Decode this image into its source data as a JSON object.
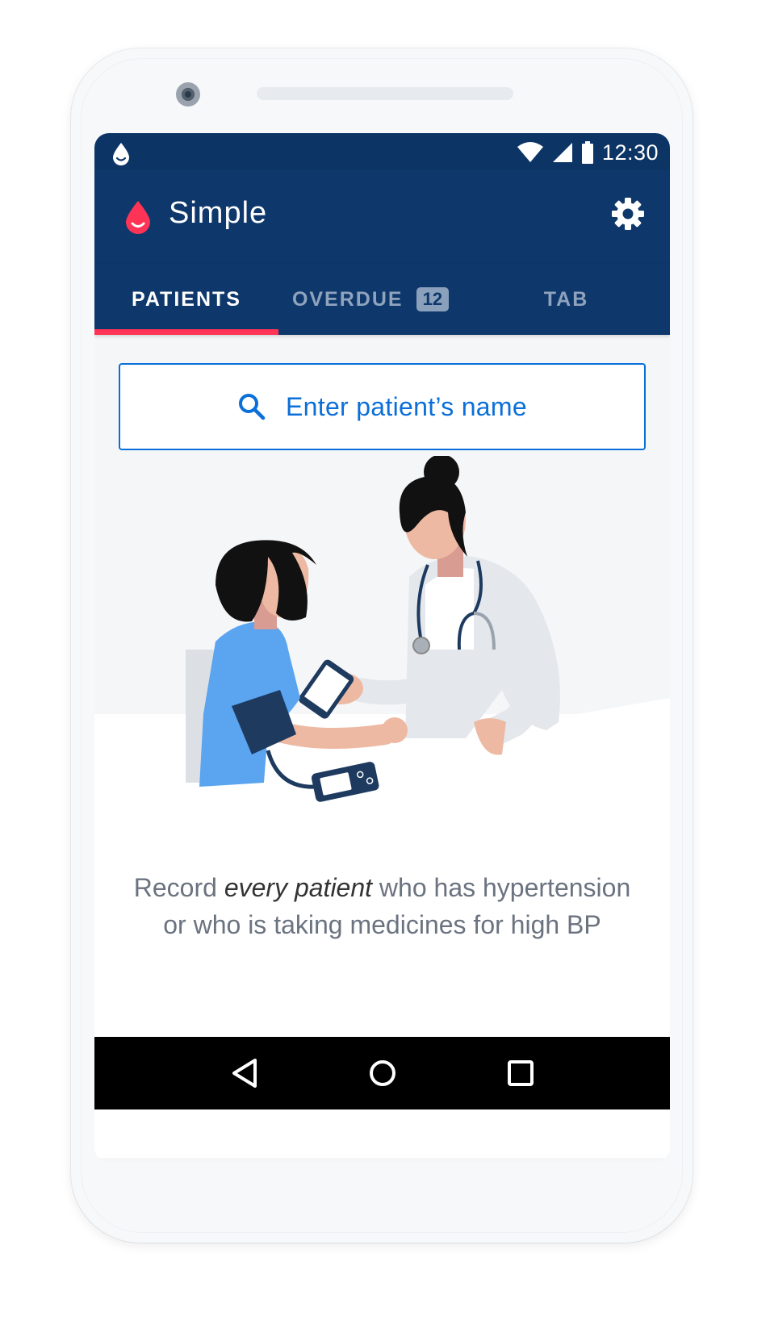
{
  "status_bar": {
    "time": "12:30"
  },
  "app": {
    "title": "Simple"
  },
  "tabs": [
    {
      "label": "PATIENTS",
      "active": true
    },
    {
      "label": "OVERDUE",
      "badge": "12",
      "active": false
    },
    {
      "label": "TAB",
      "active": false
    }
  ],
  "search": {
    "placeholder": "Enter patient’s name"
  },
  "caption": {
    "before": "Record ",
    "emphasis": "every patient",
    "after": " who has hypertension or who is taking medicines for high BP"
  },
  "icons": {
    "status_left": "drop-icon",
    "wifi": "wifi-icon",
    "signal": "signal-icon",
    "battery": "battery-icon",
    "logo": "blood-drop-logo",
    "settings": "gear-icon",
    "search": "search-icon",
    "nav": [
      "back-icon",
      "home-icon",
      "recents-icon"
    ]
  },
  "colors": {
    "primary": "#0e386b",
    "accent": "#ff3355",
    "link": "#0b6fd8"
  }
}
